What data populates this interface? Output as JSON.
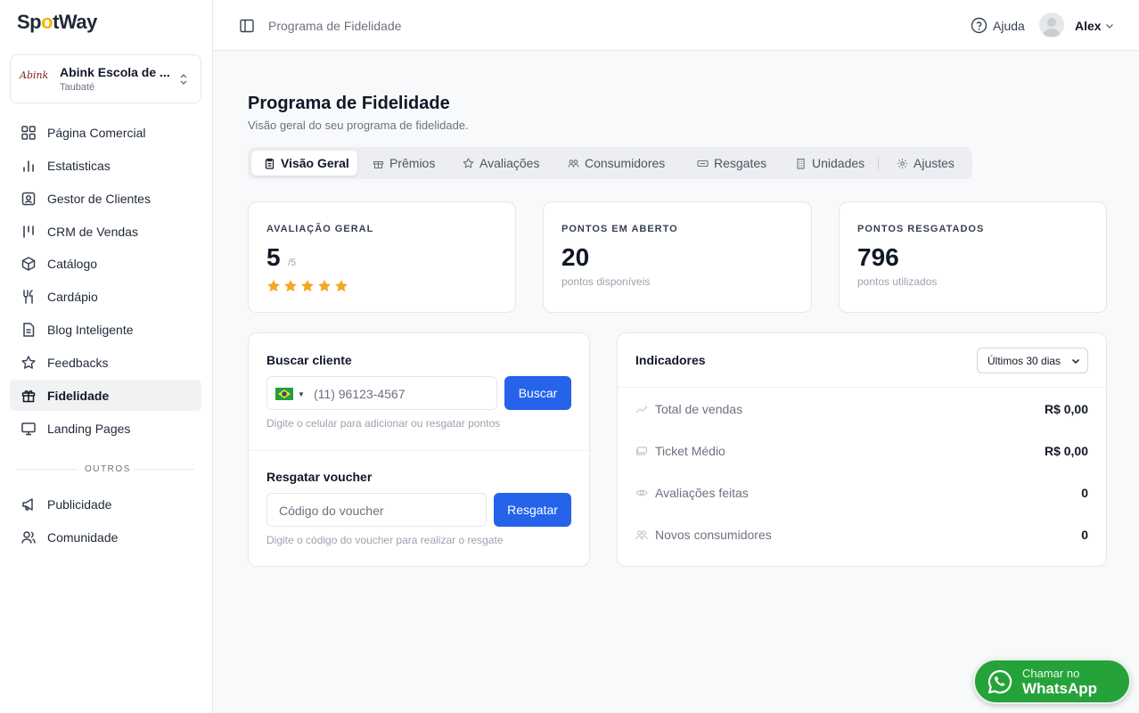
{
  "brand": {
    "logo_text_a": "Sp",
    "logo_text_o": "o",
    "logo_text_b": "tWay",
    "accent": "#f5b400"
  },
  "org": {
    "name": "Abink Escola de ...",
    "city": "Taubaté",
    "logo_text": "Abink"
  },
  "nav": {
    "items": [
      {
        "label": "Página Comercial",
        "icon": "grid-icon"
      },
      {
        "label": "Estatisticas",
        "icon": "bar-chart-icon"
      },
      {
        "label": "Gestor de Clientes",
        "icon": "contact-icon"
      },
      {
        "label": "CRM de Vendas",
        "icon": "kanban-icon"
      },
      {
        "label": "Catálogo",
        "icon": "box-icon"
      },
      {
        "label": "Cardápio",
        "icon": "utensils-icon"
      },
      {
        "label": "Blog Inteligente",
        "icon": "document-icon"
      },
      {
        "label": "Feedbacks",
        "icon": "star-icon"
      },
      {
        "label": "Fidelidade",
        "icon": "gift-icon",
        "active": true
      },
      {
        "label": "Landing Pages",
        "icon": "monitor-icon"
      }
    ],
    "section_label": "OUTROS",
    "other_items": [
      {
        "label": "Publicidade",
        "icon": "megaphone-icon"
      },
      {
        "label": "Comunidade",
        "icon": "users-icon"
      }
    ]
  },
  "topbar": {
    "breadcrumb": "Programa de Fidelidade",
    "help_label": "Ajuda",
    "user_name": "Alex"
  },
  "page": {
    "title": "Programa de Fidelidade",
    "subtitle": "Visão geral do seu programa de fidelidade."
  },
  "tabs": [
    {
      "label": "Visão Geral",
      "icon": "clipboard-icon",
      "active": true
    },
    {
      "label": "Prêmios",
      "icon": "gift-icon"
    },
    {
      "label": "Avaliações",
      "icon": "star-icon"
    },
    {
      "label": "Consumidores",
      "icon": "users-icon"
    },
    {
      "label": "Resgates",
      "icon": "ticket-icon"
    },
    {
      "label": "Unidades",
      "icon": "building-icon"
    },
    {
      "label": "Ajustes",
      "icon": "gear-icon"
    }
  ],
  "stats": {
    "rating": {
      "label": "AVALIAÇÃO GERAL",
      "value": "5",
      "suffix": "/5",
      "stars": 5,
      "star_color": "#f5a623"
    },
    "open_points": {
      "label": "PONTOS EM ABERTO",
      "value": "20",
      "note": "pontos disponíveis"
    },
    "redeemed_points": {
      "label": "PONTOS RESGATADOS",
      "value": "796",
      "note": "pontos utilizados"
    }
  },
  "search": {
    "title": "Buscar cliente",
    "phone_placeholder": "(11) 96123-4567",
    "button": "Buscar",
    "hint": "Digite o celular para adicionar ou resgatar pontos"
  },
  "voucher": {
    "title": "Resgatar voucher",
    "placeholder": "Código do voucher",
    "button": "Resgatar",
    "hint": "Digite o código do voucher para realizar o resgate"
  },
  "indicators": {
    "title": "Indicadores",
    "period": "Últimos 30 dias",
    "rows": [
      {
        "label": "Total de vendas",
        "value": "R$ 0,00",
        "icon": "trend-icon"
      },
      {
        "label": "Ticket Médio",
        "value": "R$ 0,00",
        "icon": "cash-icon"
      },
      {
        "label": "Avaliações feitas",
        "value": "0",
        "icon": "eye-icon"
      },
      {
        "label": "Novos consumidores",
        "value": "0",
        "icon": "users-icon"
      }
    ]
  },
  "whatsapp": {
    "small": "Chamar no",
    "big": "WhatsApp",
    "color": "#25a33a"
  }
}
